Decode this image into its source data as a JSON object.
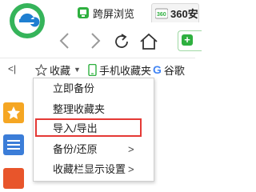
{
  "tabs": {
    "tab1_label": "跨屏浏览",
    "tab2_label": "360安"
  },
  "bookmarks_bar": {
    "left_label": "<|",
    "favorites_label": "收藏",
    "mobile_label": "手机收藏夹",
    "google_label": "谷歌",
    "google_letter": "G"
  },
  "menu": {
    "items": [
      {
        "label": "立即备份",
        "has_submenu": false
      },
      {
        "label": "整理收藏夹",
        "has_submenu": false
      },
      {
        "label": "导入/导出",
        "has_submenu": false,
        "highlighted": true
      },
      {
        "label": "备份/还原",
        "has_submenu": true
      },
      {
        "label": "收藏栏显示设置",
        "has_submenu": true
      }
    ],
    "submenu_arrow": ">"
  },
  "colors": {
    "accent_green": "#2eb03f",
    "highlight_red": "#e53935",
    "star_yellow": "#f5a623"
  }
}
